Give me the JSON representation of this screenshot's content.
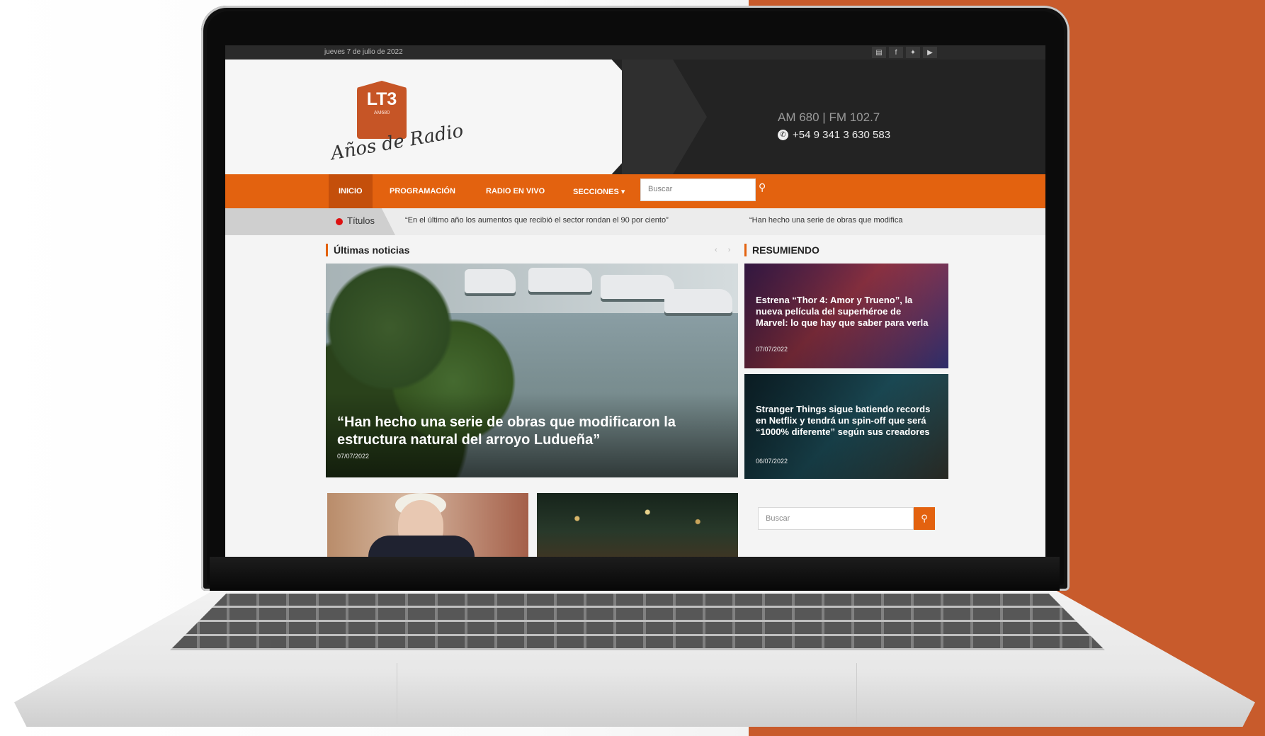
{
  "topbar": {
    "date": "jueves 7 de julio de 2022",
    "social": [
      {
        "icon": "rss-icon",
        "glyph": "▤"
      },
      {
        "icon": "facebook-icon",
        "glyph": "f"
      },
      {
        "icon": "twitter-icon",
        "glyph": "✦"
      },
      {
        "icon": "youtube-icon",
        "glyph": "▶"
      }
    ]
  },
  "header": {
    "logo_text": "LT3",
    "logo_sub": "AM680",
    "logo_script": "Años de Radio",
    "frequencies": "AM 680 | FM 102.7",
    "phone": "+54 9 341 3 630 583"
  },
  "nav": {
    "items": [
      "INICIO",
      "PROGRAMACIÓN",
      "RADIO EN VIVO",
      "SECCIONES ▾"
    ],
    "search_placeholder": "Buscar"
  },
  "ticker": {
    "label": "Títulos",
    "items": [
      "“En el último año los aumentos que recibió el sector rondan el 90 por ciento”",
      "“Han hecho una serie de obras que modifica"
    ]
  },
  "main": {
    "latest_title": "Últimas noticias",
    "arrows": "‹ ›",
    "hero": {
      "title": "“Han hecho una serie de obras que modificaron la estructura natural del arroyo Ludueña”",
      "date": "07/07/2022"
    }
  },
  "sidebar": {
    "title": "RESUMIENDO",
    "cards": [
      {
        "title": "Estrena “Thor 4: Amor y Trueno”, la nueva película del superhéroe de Marvel: lo que hay que saber para verla",
        "date": "07/07/2022"
      },
      {
        "title": "Stranger Things sigue batiendo records en Netflix y tendrá un spin-off que será “1000% diferente” según sus creadores",
        "date": "06/07/2022"
      }
    ],
    "search_placeholder": "Buscar"
  },
  "colors": {
    "accent": "#e3620f",
    "brand_bg": "#c85b2c",
    "dark": "#232323"
  }
}
